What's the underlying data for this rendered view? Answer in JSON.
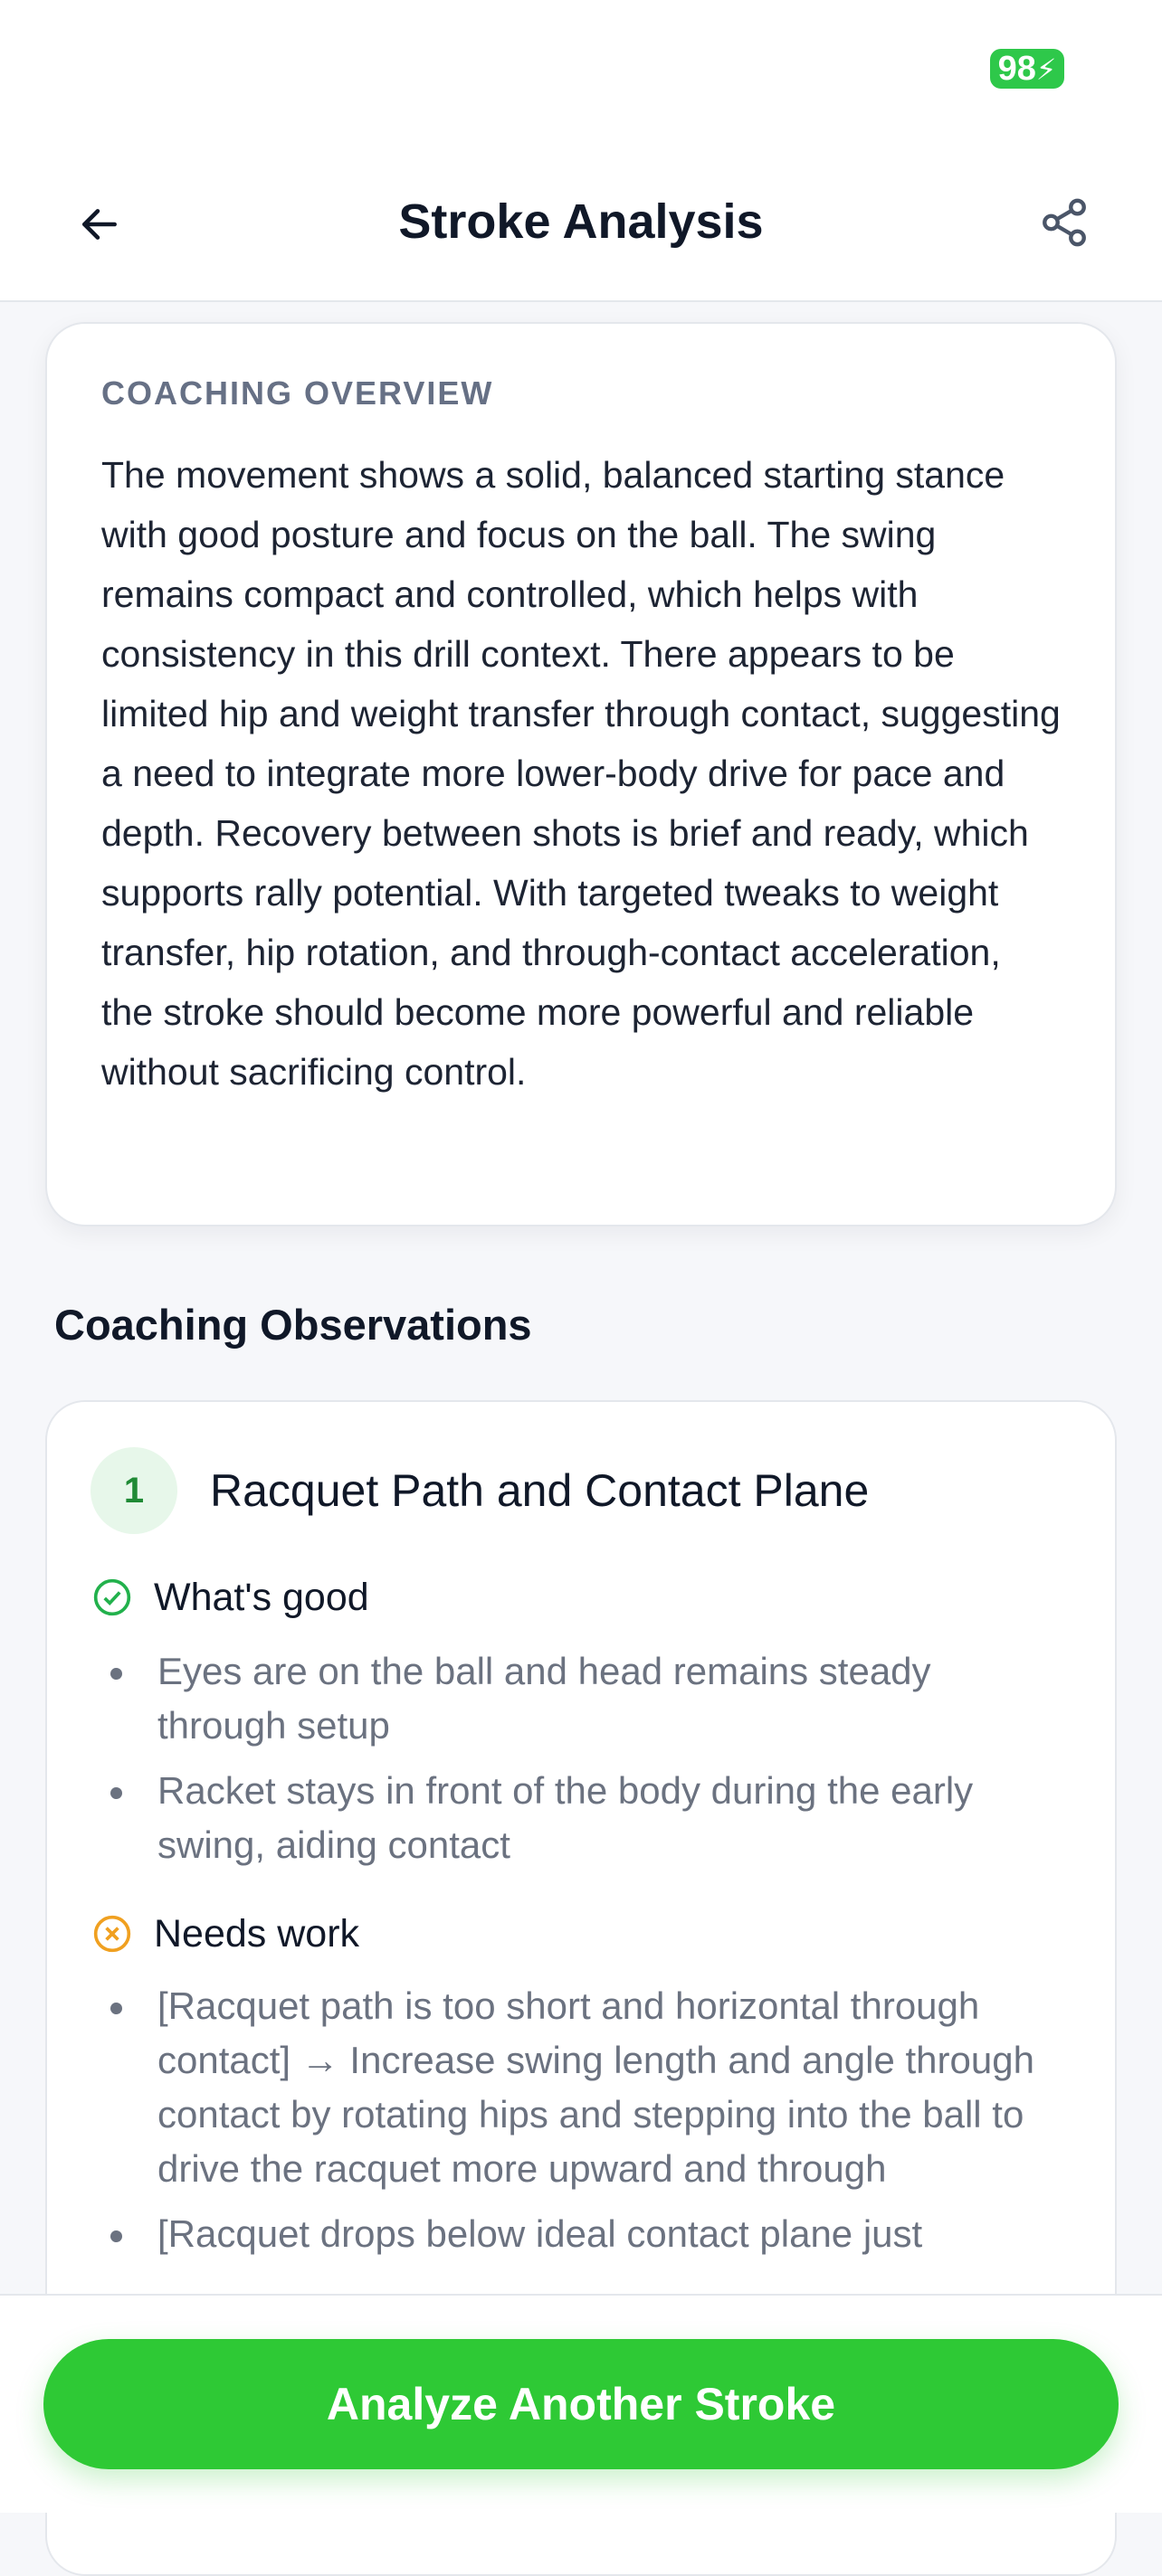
{
  "status_bar": {
    "battery": "98"
  },
  "header": {
    "title": "Stroke Analysis",
    "back_icon": "arrow-left-icon",
    "share_icon": "share-icon"
  },
  "overview": {
    "label": "COACHING OVERVIEW",
    "text": "The movement shows a solid, balanced starting stance with good posture and focus on the ball. The swing remains compact and controlled, which helps with consistency in this drill context. There appears to be limited hip and weight transfer through contact, suggesting a need to integrate more lower-body drive for pace and depth. Recovery between shots is brief and ready, which supports rally potential. With targeted tweaks to weight transfer, hip rotation, and through-contact acceleration, the stroke should become more powerful and reliable without sacrificing control."
  },
  "observations": {
    "section_title": "Coaching Observations",
    "items": [
      {
        "number": "1",
        "title": "Racquet Path and Contact Plane",
        "good_label": "What's good",
        "good": [
          "Eyes are on the ball and head remains steady through setup",
          "Racket stays in front of the body during the early swing, aiding contact"
        ],
        "work_label": "Needs work",
        "work": [
          "[Racquet path is too short and horizontal through contact] → Increase swing length and angle through contact by rotating hips and stepping into the ball to drive the racquet more upward and through",
          "[Racquet drops below ideal contact plane just"
        ]
      }
    ]
  },
  "colors": {
    "accent_green": "#2ec935",
    "good_icon": "#22b14c",
    "warn_icon": "#f0a020"
  },
  "footer": {
    "cta_label": "Analyze Another Stroke"
  }
}
